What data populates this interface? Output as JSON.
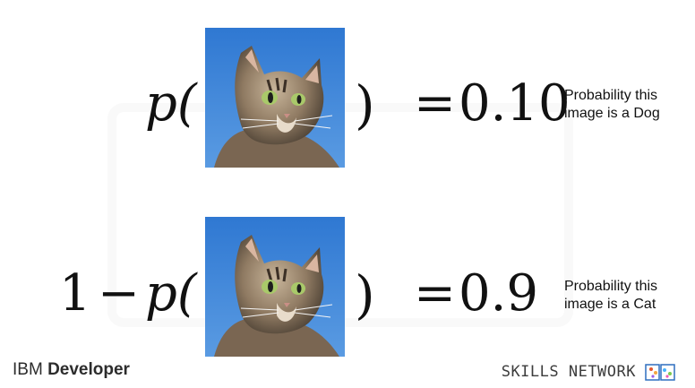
{
  "row1": {
    "fn_prefix": "p(",
    "close_paren": ")",
    "equals": "=",
    "value": "0.10",
    "caption_line1": "Probability this",
    "caption_line2": "image is a Dog"
  },
  "row2": {
    "one": "1",
    "minus": "−",
    "fn_prefix": "p(",
    "close_paren": ")",
    "equals": "=",
    "value": "0.9",
    "caption_line1": "Probability this",
    "caption_line2": "image is a Cat"
  },
  "footer": {
    "brand_left": "IBM",
    "brand_left_product": "Developer",
    "brand_right": "SKILLS NETWORK"
  },
  "colors": {
    "sky": "#3d85d8",
    "text": "#111111",
    "footer_text": "#3c3c3c"
  },
  "images": {
    "cat_photo_icon": "cat-photo"
  }
}
